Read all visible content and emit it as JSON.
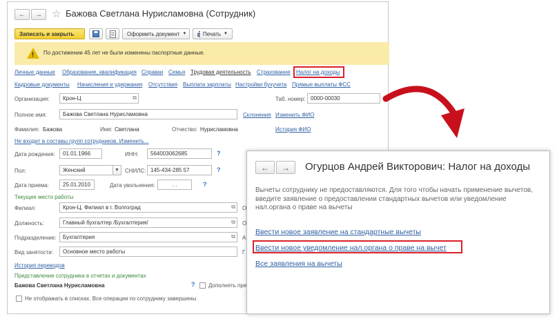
{
  "employee_window": {
    "title": "Бажова Светлана Нурисламовна (Сотрудник)",
    "toolbar": {
      "save_close": "Записать и закрыть",
      "create_document": "Оформить документ",
      "print": "Печать"
    },
    "warning": "По достижении 45 лет не были изменены паспортные данные.",
    "tabs_row1": [
      "Личные данные",
      "Образование, квалификация",
      "Справки",
      "Семья",
      "Трудовая деятельность",
      "Страхование",
      "Налог на доходы"
    ],
    "tabs_row2": [
      "Кадровые документы",
      "Начисления и удержания",
      "Отсутствия",
      "Выплата зарплаты",
      "Настройки бухучета",
      "Прямые выплаты ФСС"
    ],
    "fields": {
      "organization_label": "Организация:",
      "organization": "Крон-Ц",
      "tab_number_label": "Таб. номер:",
      "tab_number": "0000-00030",
      "full_name_label": "Полное имя:",
      "full_name": "Бажова Светлана Нурисламовна",
      "declension_link": "Склонения",
      "change_fio_link": "Изменить ФИО",
      "surname_label": "Фамилия:",
      "surname": "Бажова",
      "name_label": "Имя:",
      "name": "Светлана",
      "patronymic_label": "Отчество:",
      "patronymic": "Нурисламовна",
      "fio_history_link": "История ФИО",
      "groups_link": "Не входит в составы групп сотрудников. Изменить...",
      "birth_date_label": "Дата рождения:",
      "birth_date": "01.01.1966",
      "inn_label": "ИНН:",
      "inn": "564003062685",
      "gender_label": "Пол:",
      "gender": "Женский",
      "snils_label": "СНИЛС:",
      "snils": "145-434-285 57",
      "hire_date_label": "Дата приема:",
      "hire_date": "25.01.2010",
      "dismissal_label": "Дата увольнения:",
      "dismissal_date": ". .",
      "q": "?"
    },
    "current_place": {
      "heading": "Текущее место работы",
      "branch_label": "Филиал:",
      "branch": "Крон-Ц. Филиал в г. Волгоград",
      "position_label": "Должность:",
      "position": "Главный бухгалтер /Бухгалтерия/",
      "division_label": "Подразделение:",
      "division": "Бухгалтерия",
      "employment_label": "Вид занятости:",
      "employment": "Основное место работы",
      "right_cut": [
        "О",
        "О",
        "А",
        "Г"
      ],
      "transfer_history": "История переводов"
    },
    "representation": {
      "heading": "Представление сотрудника в отчетах и документах",
      "name": "Бажова Светлана Нурисламовна",
      "q": "?",
      "supplement_label": "Дополнять представление",
      "hide_label": "Не отображать в списках. Все операции по сотруднику завершены"
    }
  },
  "tax_window": {
    "title": "Огурцов Андрей Викторович: Налог на доходы",
    "text": "Вычеты сотруднику не предоставляются. Для того чтобы начать применение вычетов, введите заявление о предоставлении стандартных вычетов или уведомление нал.органа о праве на вычеты",
    "links": {
      "standard": "Ввести новое заявление на стандартные вычеты",
      "notification": "Ввести новое уведомление нал.органа о праве на вычет",
      "all": "Все заявления на вычеты"
    }
  },
  "colors": {
    "link": "#2e5fa3",
    "highlight": "#d9202a",
    "primary_button": "#f3cf2f",
    "warning_band": "#fbeba8",
    "section_heading": "#3a8a3a"
  },
  "icons": [
    "back-arrow-icon",
    "forward-arrow-icon",
    "star-icon",
    "save-icon",
    "document-icon",
    "print-icon",
    "warning-icon",
    "dropdown-arrow-icon",
    "open-icon",
    "calendar-icon",
    "help-icon"
  ]
}
